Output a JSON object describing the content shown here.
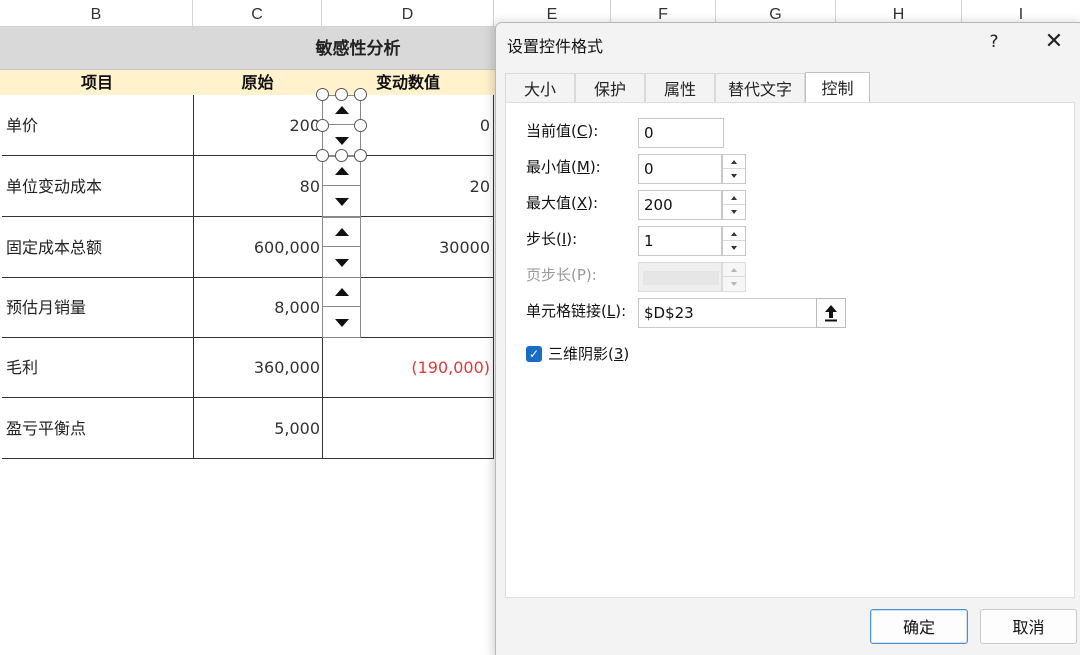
{
  "columns": [
    "B",
    "C",
    "D",
    "E",
    "F",
    "G",
    "H",
    "I"
  ],
  "sheet": {
    "title": "敏感性分析",
    "headers": [
      "项目",
      "原始",
      "变动数值"
    ],
    "rows": [
      {
        "label": "单价",
        "original": "200",
        "change": "0"
      },
      {
        "label": "单位变动成本",
        "original": "80",
        "change": "20"
      },
      {
        "label": "固定成本总额",
        "original": "600,000",
        "change": "30000"
      },
      {
        "label": "预估月销量",
        "original": "8,000",
        "change": ""
      },
      {
        "label": "毛利",
        "original": "360,000",
        "change": "(190,000)"
      },
      {
        "label": "盈亏平衡点",
        "original": "5,000",
        "change": ""
      }
    ],
    "negative_color": "#e03a3a"
  },
  "dialog": {
    "title": "设置控件格式",
    "help": "?",
    "close": "✕",
    "tabs": [
      "大小",
      "保护",
      "属性",
      "替代文字",
      "控制"
    ],
    "active_tab": "控制",
    "fields": {
      "current_value": {
        "label_pre": "当前值(",
        "key": "C",
        "label_post": "):",
        "value": "0"
      },
      "min_value": {
        "label_pre": "最小值(",
        "key": "M",
        "label_post": "):",
        "value": "0"
      },
      "max_value": {
        "label_pre": "最大值(",
        "key": "X",
        "label_post": "):",
        "value": "200"
      },
      "step": {
        "label_pre": "步长(",
        "key": "I",
        "label_post": "):",
        "value": "1"
      },
      "page_step": {
        "label": "页步长(P):",
        "value": ""
      },
      "cell_link": {
        "label_pre": "单元格链接(",
        "key": "L",
        "label_post": "):",
        "value": "$D$23"
      }
    },
    "shading": {
      "label_pre": "三维阴影(",
      "key": "3",
      "label_post": ")",
      "checked": true
    },
    "ok_label": "确定",
    "cancel_label": "取消"
  },
  "colors": {
    "accent": "#1a6bc7",
    "header_fill": "#fff2cc",
    "title_fill": "#d9d9d9"
  }
}
